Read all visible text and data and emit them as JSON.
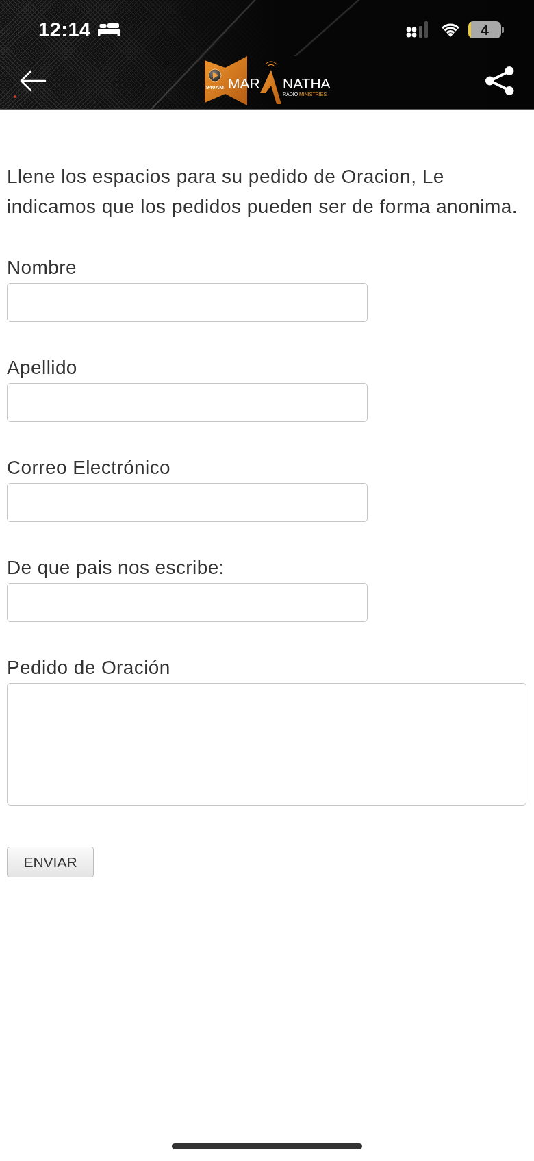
{
  "status_bar": {
    "time": "12:14",
    "battery": "4"
  },
  "header": {
    "logo": {
      "badge": "940AM",
      "name_start": "MAR",
      "name_end": "NATHA",
      "line_1": "RADIO",
      "line_2": "MINISTRIES"
    }
  },
  "form": {
    "intro": "Llene los espacios para su pedido de Oracion, Le indicamos que los pedidos pueden ser de forma anonima.",
    "fields": [
      {
        "label": "Nombre",
        "kind": "text"
      },
      {
        "label": "Apellido",
        "kind": "text"
      },
      {
        "label": "Correo Electrónico",
        "kind": "text"
      },
      {
        "label": "De que pais nos escribe:",
        "kind": "text"
      },
      {
        "label": "Pedido de Oración",
        "kind": "textarea"
      }
    ],
    "submit": "ENVIAR"
  }
}
